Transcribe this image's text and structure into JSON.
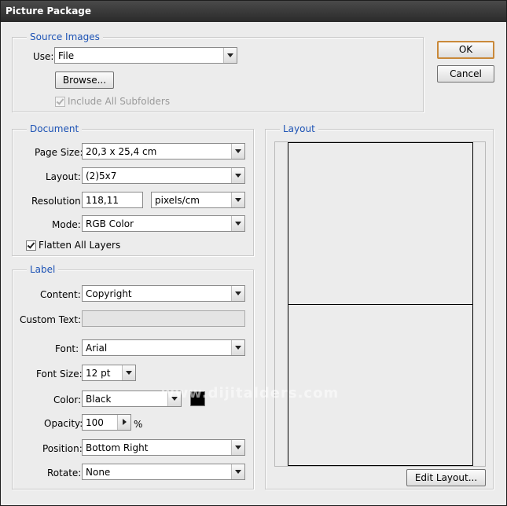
{
  "window": {
    "title": "Picture Package"
  },
  "buttons": {
    "ok": "OK",
    "cancel": "Cancel",
    "browse": "Browse...",
    "edit_layout": "Edit Layout..."
  },
  "source_images": {
    "legend": "Source Images",
    "use_label": "Use:",
    "use_value": "File",
    "include_subfolders_label": "Include All Subfolders",
    "include_subfolders_checked": true
  },
  "document": {
    "legend": "Document",
    "page_size_label": "Page Size:",
    "page_size_value": "20,3 x 25,4 cm",
    "layout_label": "Layout:",
    "layout_value": "(2)5x7",
    "resolution_label": "Resolution:",
    "resolution_value": "118,11",
    "resolution_unit": "pixels/cm",
    "mode_label": "Mode:",
    "mode_value": "RGB Color",
    "flatten_label": "Flatten All Layers",
    "flatten_checked": true
  },
  "label": {
    "legend": "Label",
    "content_label": "Content:",
    "content_value": "Copyright",
    "custom_text_label": "Custom Text:",
    "custom_text_value": "",
    "font_label": "Font:",
    "font_value": "Arial",
    "font_size_label": "Font Size:",
    "font_size_value": "12 pt",
    "color_label": "Color:",
    "color_value": "Black",
    "color_swatch": "#000000",
    "opacity_label": "Opacity:",
    "opacity_value": "100",
    "opacity_unit": "%",
    "position_label": "Position:",
    "position_value": "Bottom Right",
    "rotate_label": "Rotate:",
    "rotate_value": "None"
  },
  "layout_panel": {
    "legend": "Layout"
  },
  "watermark": "www.dijitalders.com"
}
